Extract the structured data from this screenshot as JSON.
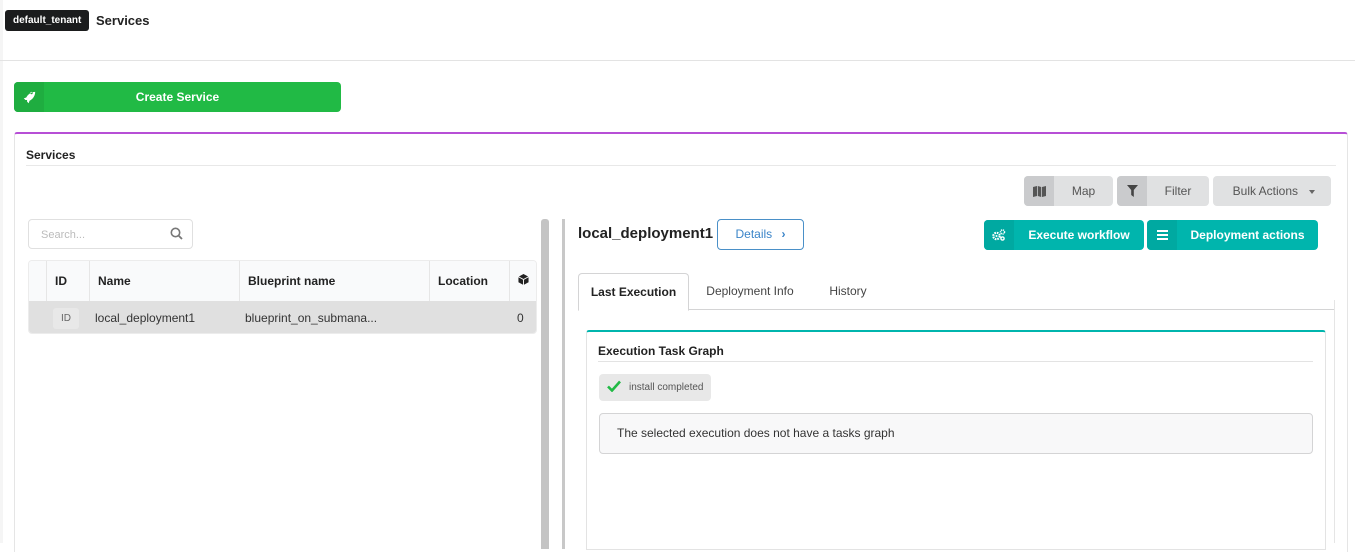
{
  "header": {
    "tenant": "default_tenant",
    "page_title": "Services"
  },
  "create_service": {
    "label": "Create Service",
    "icon": "rocket-icon",
    "color": "#21ba45"
  },
  "widget": {
    "title": "Services",
    "accent_color": "#b74fd6",
    "toolbar": {
      "map_label": "Map",
      "filter_label": "Filter",
      "bulk_actions_label": "Bulk Actions"
    },
    "search": {
      "placeholder": "Search...",
      "value": ""
    },
    "table": {
      "columns": [
        "ID",
        "Name",
        "Blueprint name",
        "Location",
        "cube-icon"
      ],
      "rows": [
        {
          "id": "ID",
          "name": "local_deployment1",
          "blueprint_name": "blueprint_on_submana...",
          "location": "",
          "count": "0"
        }
      ]
    }
  },
  "detail": {
    "deployment_name": "local_deployment1",
    "details_label": "Details",
    "execute_workflow_label": "Execute workflow",
    "deployment_actions_label": "Deployment actions",
    "action_color": "#00b5ad",
    "tabs": [
      {
        "label": "Last Execution",
        "active": true
      },
      {
        "label": "Deployment Info",
        "active": false
      },
      {
        "label": "History",
        "active": false
      }
    ],
    "task_graph": {
      "title": "Execution Task Graph",
      "status_text": "install completed",
      "status_color": "#21ba45",
      "message": "The selected execution does not have a tasks graph"
    }
  }
}
